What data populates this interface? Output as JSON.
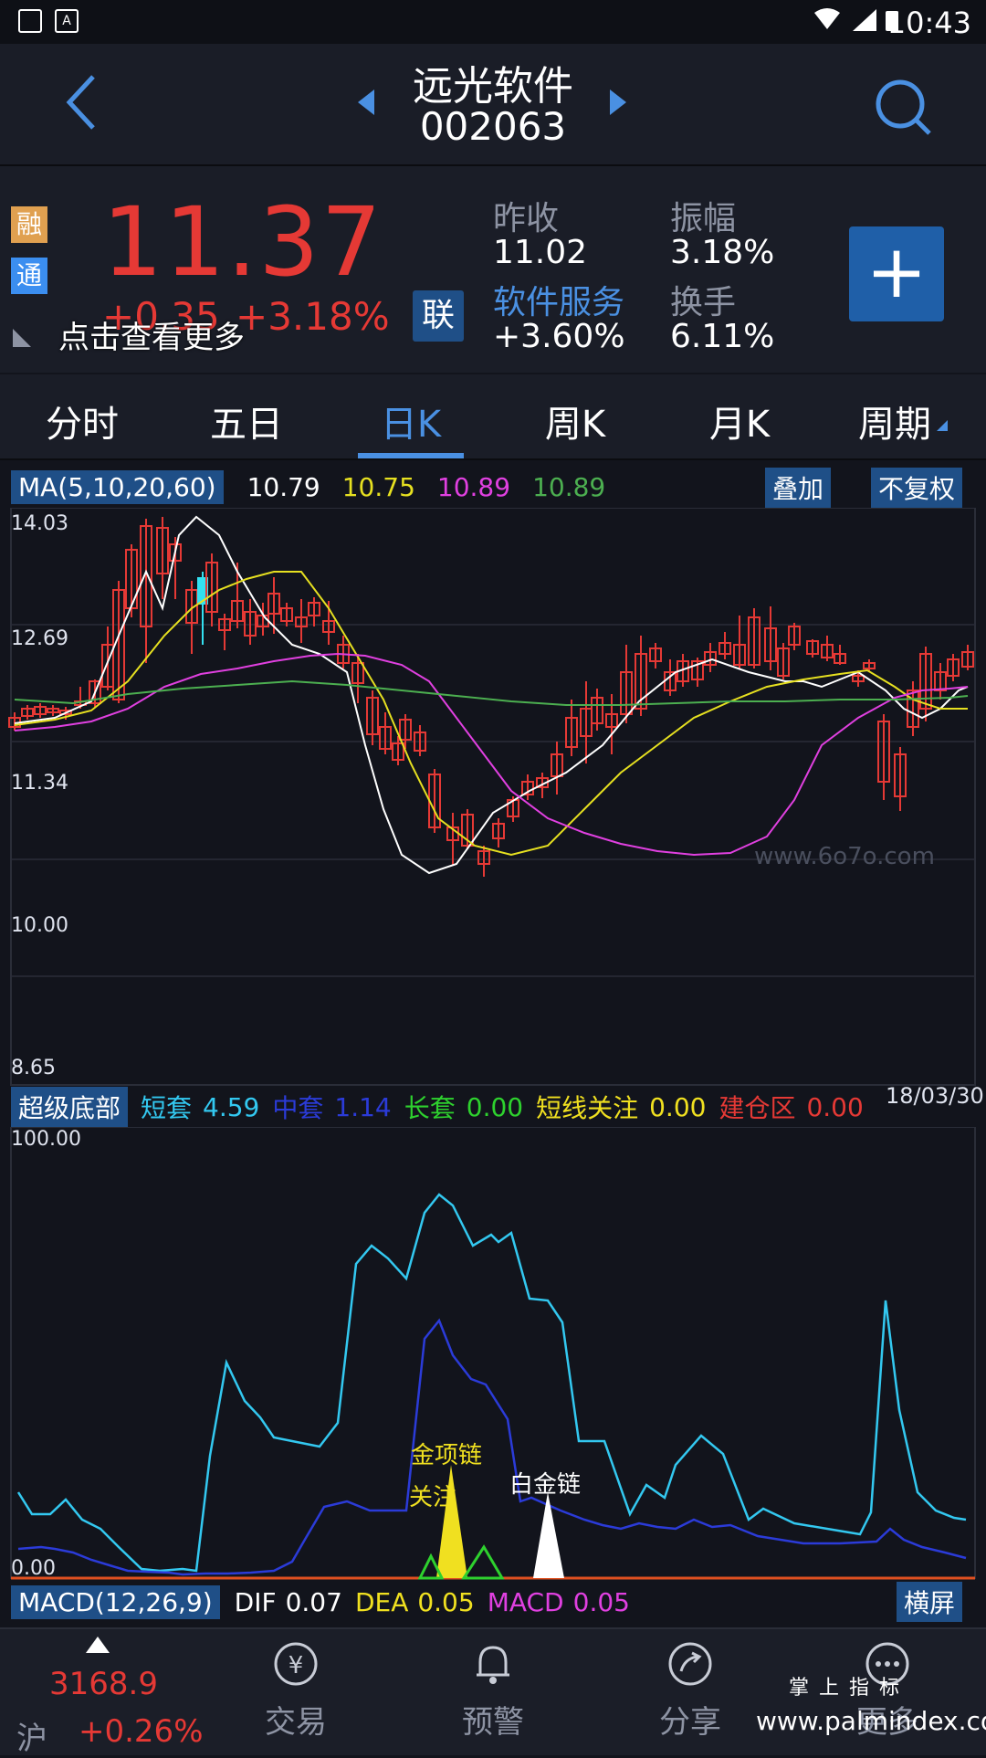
{
  "status_bar": {
    "time": "10:43",
    "icon_a": "A"
  },
  "header": {
    "name": "远光软件",
    "code": "002063"
  },
  "quote": {
    "badge_rong": "融",
    "badge_tong": "通",
    "price": "11.37",
    "change": "+0.35",
    "change_pct": "+3.18%",
    "more_text": "点击查看更多",
    "lian_button": "联",
    "prev_close_label": "昨收",
    "prev_close": "11.02",
    "amplitude_label": "振幅",
    "amplitude": "3.18%",
    "sector_label": "软件服务",
    "sector_change": "+3.60%",
    "turnover_label": "换手",
    "turnover": "6.11%",
    "add_button": "+"
  },
  "tabs": [
    {
      "label": "分时"
    },
    {
      "label": "五日"
    },
    {
      "label": "日K"
    },
    {
      "label": "周K"
    },
    {
      "label": "月K"
    },
    {
      "label": "周期"
    }
  ],
  "active_tab": "日K",
  "ma": {
    "label": "MA(5,10,20,60)",
    "v5": "10.79",
    "v10": "10.75",
    "v20": "10.89",
    "v60": "10.89",
    "overlay_button": "叠加",
    "adjust_button": "不复权"
  },
  "kline_axis": {
    "y_ticks": [
      "14.03",
      "12.69",
      "11.34",
      "10.00",
      "8.65"
    ]
  },
  "watermark": "www.6o7o.com",
  "indicator": {
    "name": "超级底部",
    "short_label": "短套",
    "short_val": "4.59",
    "mid_label": "中套",
    "mid_val": "1.14",
    "long_label": "长套",
    "long_val": "0.00",
    "watch_label": "短线关注",
    "watch_val": "0.00",
    "build_label": "建仓区",
    "build_val": "0.00",
    "date": "18/03/30",
    "y_top": "100.00",
    "y_bottom": "0.00",
    "annot_gold": "金项链",
    "annot_watch": "关注",
    "annot_white": "白金链"
  },
  "macd": {
    "label": "MACD(12,26,9)",
    "dif_label": "DIF",
    "dif": "0.07",
    "dea_label": "DEA",
    "dea": "0.05",
    "macd_label": "MACD",
    "macd_val": "0.05",
    "landscape_button": "横屏"
  },
  "bottom_nav": {
    "index_value": "3168.9",
    "index_name": "沪",
    "index_change": "+0.26%",
    "trade": "交易",
    "alert": "预警",
    "share": "分享",
    "more": "更多"
  },
  "brand_watermark": {
    "line1": "掌 上 指 标",
    "line2": "www.palmindex.com"
  },
  "colors": {
    "up": "#e53935",
    "down": "#33e0f0",
    "accent": "#4a90e2",
    "ma5": "#ffffff",
    "ma10": "#e6e020",
    "ma20": "#e040e0",
    "ma60": "#4caf50"
  }
}
